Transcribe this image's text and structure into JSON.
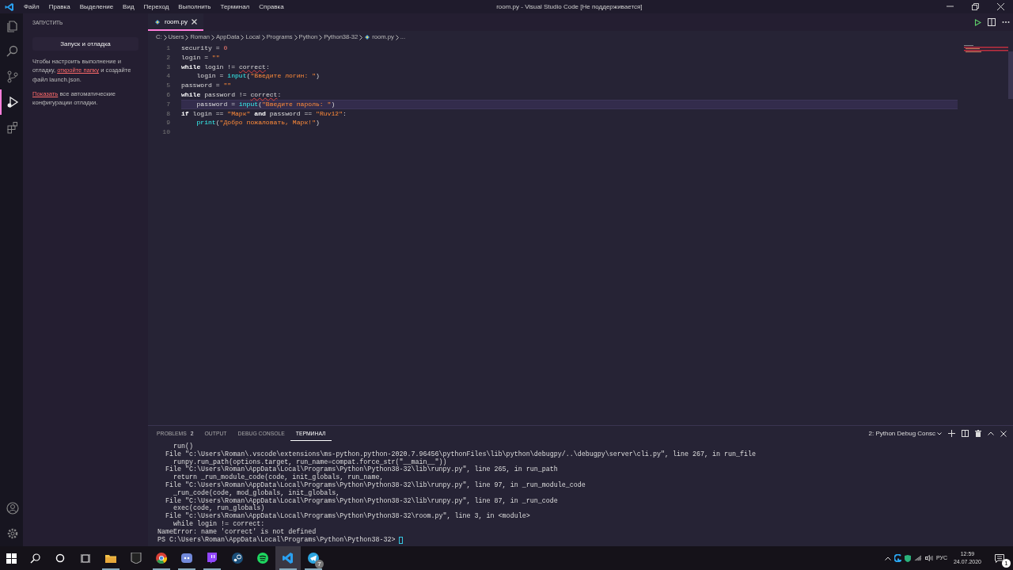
{
  "window": {
    "title": "room.py - Visual Studio Code [Не поддерживается]"
  },
  "menu": [
    "Файл",
    "Правка",
    "Выделение",
    "Вид",
    "Переход",
    "Выполнить",
    "Терминал",
    "Справка"
  ],
  "activity": [
    {
      "kind": "files",
      "selected": false
    },
    {
      "kind": "search",
      "selected": false
    },
    {
      "kind": "git",
      "selected": false
    },
    {
      "kind": "run",
      "selected": true
    },
    {
      "kind": "extensions",
      "selected": false
    }
  ],
  "activity_bottom": [
    {
      "kind": "account"
    },
    {
      "kind": "settings"
    }
  ],
  "sidebar": {
    "title": "ЗАПУСТИТЬ",
    "button": "Запуск и отладка",
    "paragraphs": [
      {
        "before": "Чтобы настроить выполнение и отладку, ",
        "link": "откройте папку",
        "after": " и создайте файл launch.json."
      },
      {
        "link": "Показать",
        "after": " все автоматические конфигурации отладки."
      }
    ]
  },
  "tabs": [
    {
      "label": "room.py",
      "selected": true
    }
  ],
  "breadcrumb": [
    "C:",
    "Users",
    "Roman",
    "AppData",
    "Local",
    "Programs",
    "Python",
    "Python38-32",
    "room.py",
    "..."
  ],
  "code": [
    {
      "indented": false,
      "current": false,
      "tokens": [
        {
          "kind": "plain",
          "t": "security = "
        },
        {
          "kind": "num",
          "t": "0"
        }
      ]
    },
    {
      "indented": false,
      "current": false,
      "tokens": [
        {
          "kind": "plain",
          "t": "login = "
        },
        {
          "kind": "str",
          "t": "\"\""
        }
      ]
    },
    {
      "indented": false,
      "current": false,
      "tokens": [
        {
          "kind": "kw",
          "t": "while"
        },
        {
          "kind": "plain",
          "t": " login != "
        },
        {
          "kind": "err",
          "t": "correct"
        },
        {
          "kind": "plain",
          "t": ":"
        }
      ]
    },
    {
      "indented": true,
      "current": false,
      "tokens": [
        {
          "kind": "plain",
          "t": "login = "
        },
        {
          "kind": "fn",
          "t": "input"
        },
        {
          "kind": "plain",
          "t": "("
        },
        {
          "kind": "str",
          "t": "\"Введите логин: \""
        },
        {
          "kind": "plain",
          "t": ")"
        }
      ]
    },
    {
      "indented": false,
      "current": false,
      "tokens": [
        {
          "kind": "plain",
          "t": "password = "
        },
        {
          "kind": "str",
          "t": "\"\""
        }
      ]
    },
    {
      "indented": false,
      "current": false,
      "tokens": [
        {
          "kind": "kw",
          "t": "while"
        },
        {
          "kind": "plain",
          "t": " password != "
        },
        {
          "kind": "err",
          "t": "correct"
        },
        {
          "kind": "plain",
          "t": ":"
        }
      ]
    },
    {
      "indented": true,
      "current": true,
      "tokens": [
        {
          "kind": "plain",
          "t": "password = "
        },
        {
          "kind": "fn",
          "t": "input"
        },
        {
          "kind": "plain",
          "t": "("
        },
        {
          "kind": "str",
          "t": "\"Введите пароль: \""
        },
        {
          "kind": "plain",
          "t": ")"
        }
      ]
    },
    {
      "indented": false,
      "current": false,
      "tokens": [
        {
          "kind": "kw",
          "t": "if"
        },
        {
          "kind": "plain",
          "t": " login == "
        },
        {
          "kind": "str",
          "t": "\"Марк\""
        },
        {
          "kind": "kw",
          "t": " and"
        },
        {
          "kind": "plain",
          "t": " password == "
        },
        {
          "kind": "str",
          "t": "\"Ruv12\""
        },
        {
          "kind": "plain",
          "t": ":"
        }
      ]
    },
    {
      "indented": true,
      "current": false,
      "tokens": [
        {
          "kind": "fn",
          "t": "print"
        },
        {
          "kind": "plain",
          "t": "("
        },
        {
          "kind": "str",
          "t": "\"Добро пожаловать, Марк!\""
        },
        {
          "kind": "plain",
          "t": ")"
        }
      ]
    }
  ],
  "line_numbers": [
    "1",
    "2",
    "3",
    "4",
    "5",
    "6",
    "7",
    "8",
    "9",
    "10"
  ],
  "panel": {
    "tabs": [
      {
        "label": "PROBLEMS",
        "badge": "2",
        "selected": false
      },
      {
        "label": "OUTPUT",
        "selected": false
      },
      {
        "label": "DEBUG CONSOLE",
        "selected": false
      },
      {
        "label": "ТЕРМИНАЛ",
        "selected": true
      }
    ],
    "terminal_selector": "2: Python Debug Consc",
    "lines": [
      "    run()",
      "  File \"c:\\Users\\Roman\\.vscode\\extensions\\ms-python.python-2020.7.96456\\pythonFiles\\lib\\python\\debugpy/..\\debugpy\\server\\cli.py\", line 267, in run_file",
      "    runpy.run_path(options.target, run_name=compat.force_str(\"__main__\"))",
      "  File \"C:\\Users\\Roman\\AppData\\Local\\Programs\\Python\\Python38-32\\lib\\runpy.py\", line 265, in run_path",
      "    return _run_module_code(code, init_globals, run_name,",
      "  File \"C:\\Users\\Roman\\AppData\\Local\\Programs\\Python\\Python38-32\\lib\\runpy.py\", line 97, in _run_module_code",
      "    _run_code(code, mod_globals, init_globals,",
      "  File \"C:\\Users\\Roman\\AppData\\Local\\Programs\\Python\\Python38-32\\lib\\runpy.py\", line 87, in _run_code",
      "    exec(code, run_globals)",
      "  File \"c:\\Users\\Roman\\AppData\\Local\\Programs\\Python\\Python38-32\\room.py\", line 3, in <module>",
      "    while login != correct:",
      "NameError: name 'correct' is not defined"
    ],
    "prompt": "PS C:\\Users\\Roman\\AppData\\Local\\Programs\\Python\\Python38-32> "
  },
  "taskbar": {
    "apps": [
      {
        "kind": "folder",
        "selected": false,
        "open": true
      },
      {
        "kind": "epic",
        "selected": false,
        "open": false
      },
      {
        "kind": "chrome",
        "selected": false,
        "open": true
      },
      {
        "kind": "discord",
        "selected": false,
        "open": true
      },
      {
        "kind": "twitch",
        "selected": false,
        "open": true
      },
      {
        "kind": "steam",
        "selected": false,
        "open": false
      },
      {
        "kind": "spotify",
        "selected": false,
        "open": false
      },
      {
        "kind": "vscode",
        "selected": true,
        "open": true
      },
      {
        "kind": "telegram",
        "selected": false,
        "open": true,
        "badge": "7"
      }
    ],
    "language": "РУС",
    "time": "12:59",
    "date": "24.07.2020",
    "notifications": "1"
  }
}
